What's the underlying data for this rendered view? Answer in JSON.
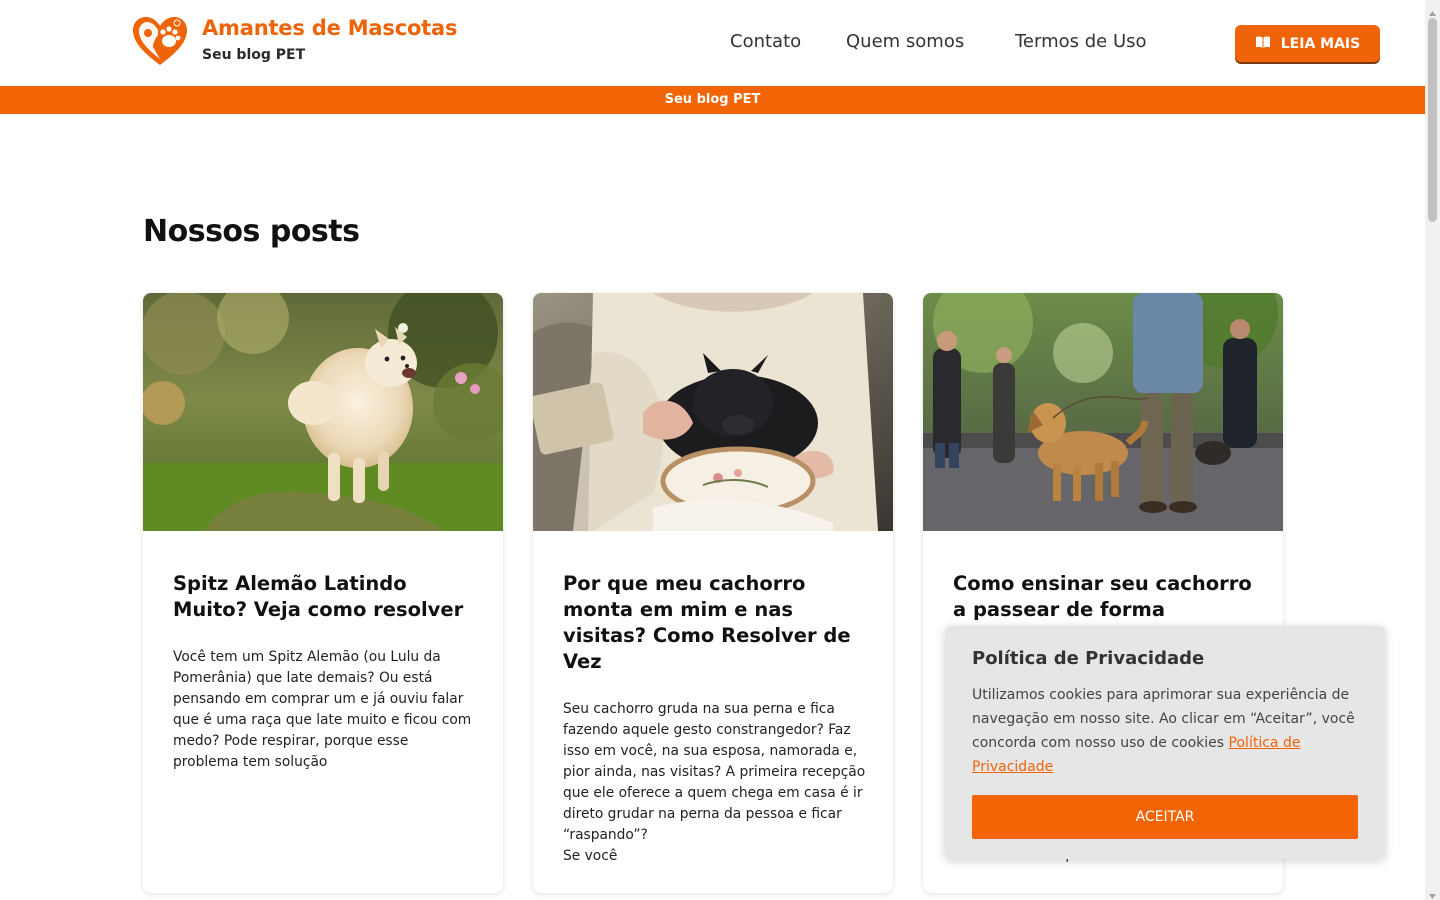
{
  "header": {
    "brand_title": "Amantes de Mascotas",
    "brand_subtitle": "Seu blog PET",
    "nav": [
      "Contato",
      "Quem somos",
      "Termos de Uso"
    ],
    "cta_label": "LEIA MAIS"
  },
  "banner": {
    "text": "Seu blog PET"
  },
  "main": {
    "section_title": "Nossos posts",
    "posts": [
      {
        "title": "Spitz Alemão Latindo Muito? Veja como resolver",
        "excerpt": "Você tem um Spitz Alemão (ou Lulu da Pomerânia) que late demais? Ou está pensando em comprar um e já ouviu falar que é uma raça que late muito e ficou com medo? Pode respirar, porque esse problema tem solução"
      },
      {
        "title": "Por que meu cachorro monta em mim e nas visitas? Como Resolver de Vez",
        "excerpt": "Seu cachorro gruda na sua perna e fica fazendo aquele gesto constrangedor? Faz isso em você, na sua esposa, namorada e, pior ainda, nas visitas? A primeira recepção que ele oferece a quem chega em casa é ir direto grudar na perna da pessoa e ficar “raspando”?\nSe você"
      },
      {
        "title": "Como ensinar seu cachorro a passear de forma",
        "excerpt": "A boa notícia é que isso"
      }
    ]
  },
  "cookie": {
    "title": "Política de Privacidade",
    "text": "Utilizamos cookies para aprimorar sua experiência de navegação em nosso site. Ao clicar em “Aceitar”, você concorda com nosso uso de cookies ",
    "link_label": "Política de Privacidade",
    "button_label": "ACEITAR"
  },
  "colors": {
    "accent": "#f06409",
    "banner": "#f26406",
    "popup_bg": "#e6e6e6"
  },
  "icons": [
    "heart-paw-logo-icon",
    "book-icon"
  ]
}
